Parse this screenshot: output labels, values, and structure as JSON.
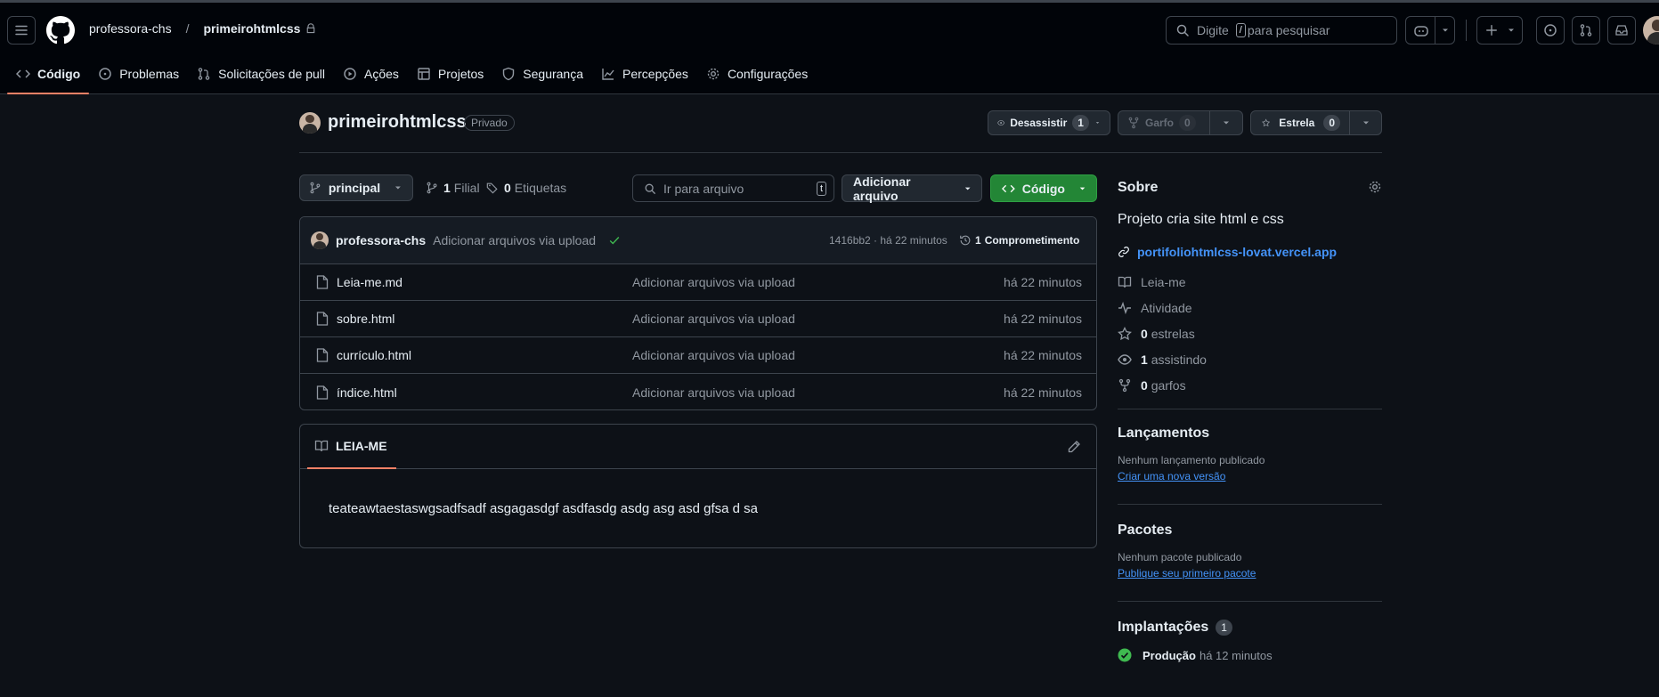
{
  "header": {
    "owner": "professora-chs",
    "separator": "/",
    "repo": "primeirohtmlcss",
    "search_prefix": "Digite",
    "search_key": "/",
    "search_suffix": "para pesquisar"
  },
  "tabs": [
    {
      "label": "Código"
    },
    {
      "label": "Problemas"
    },
    {
      "label": "Solicitações de pull"
    },
    {
      "label": "Ações"
    },
    {
      "label": "Projetos"
    },
    {
      "label": "Segurança"
    },
    {
      "label": "Percepções"
    },
    {
      "label": "Configurações"
    }
  ],
  "repo": {
    "name": "primeirohtmlcss",
    "visibility": "Privado",
    "watch_label": "Desassistir",
    "watch_count": "1",
    "fork_label": "Garfo",
    "fork_count": "0",
    "star_label": "Estrela",
    "star_count": "0"
  },
  "toolbar": {
    "branch": "principal",
    "branches_count": "1",
    "branches_label": "Filial",
    "tags_count": "0",
    "tags_label": "Etiquetas",
    "file_search_placeholder": "Ir para arquivo",
    "file_search_key": "t",
    "add_file": "Adicionar arquivo",
    "code_button": "Código"
  },
  "commit": {
    "author": "professora-chs",
    "message": "Adicionar arquivos via upload",
    "meta": "1416bb2 · há 22 minutos",
    "commits_count": "1",
    "commits_label": "Comprometimento"
  },
  "files": [
    {
      "name": "Leia-me.md",
      "message": "Adicionar arquivos via upload",
      "time": "há 22 minutos"
    },
    {
      "name": "sobre.html",
      "message": "Adicionar arquivos via upload",
      "time": "há 22 minutos"
    },
    {
      "name": "currículo.html",
      "message": "Adicionar arquivos via upload",
      "time": "há 22 minutos"
    },
    {
      "name": "índice.html",
      "message": "Adicionar arquivos via upload",
      "time": "há 22 minutos"
    }
  ],
  "readme": {
    "tab_label": "LEIA-ME",
    "content": "teateawtaestaswgsadfsadf asgagasdgf asdfasdg asdg asg asd gfsa d sa"
  },
  "about": {
    "title": "Sobre",
    "description": "Projeto cria site html e css",
    "website": "portifoliohtmlcss-lovat.vercel.app",
    "items": [
      {
        "label": "Leia-me",
        "count": ""
      },
      {
        "label": "Atividade",
        "count": ""
      },
      {
        "label": "estrelas",
        "count": "0"
      },
      {
        "label": "assistindo",
        "count": "1"
      },
      {
        "label": "garfos",
        "count": "0"
      }
    ]
  },
  "releases": {
    "title": "Lançamentos",
    "empty": "Nenhum lançamento publicado",
    "action": "Criar uma nova versão"
  },
  "packages": {
    "title": "Pacotes",
    "empty": "Nenhum pacote publicado",
    "action": "Publique seu primeiro pacote"
  },
  "deployments": {
    "title": "Implantações",
    "count": "1",
    "env": "Produção",
    "time": "há 12 minutos"
  },
  "colors": {
    "accent_green": "#238636",
    "link_blue": "#4493f8",
    "tab_underline": "#f78166",
    "bg": "#0d1117",
    "header_bg": "#010409"
  }
}
